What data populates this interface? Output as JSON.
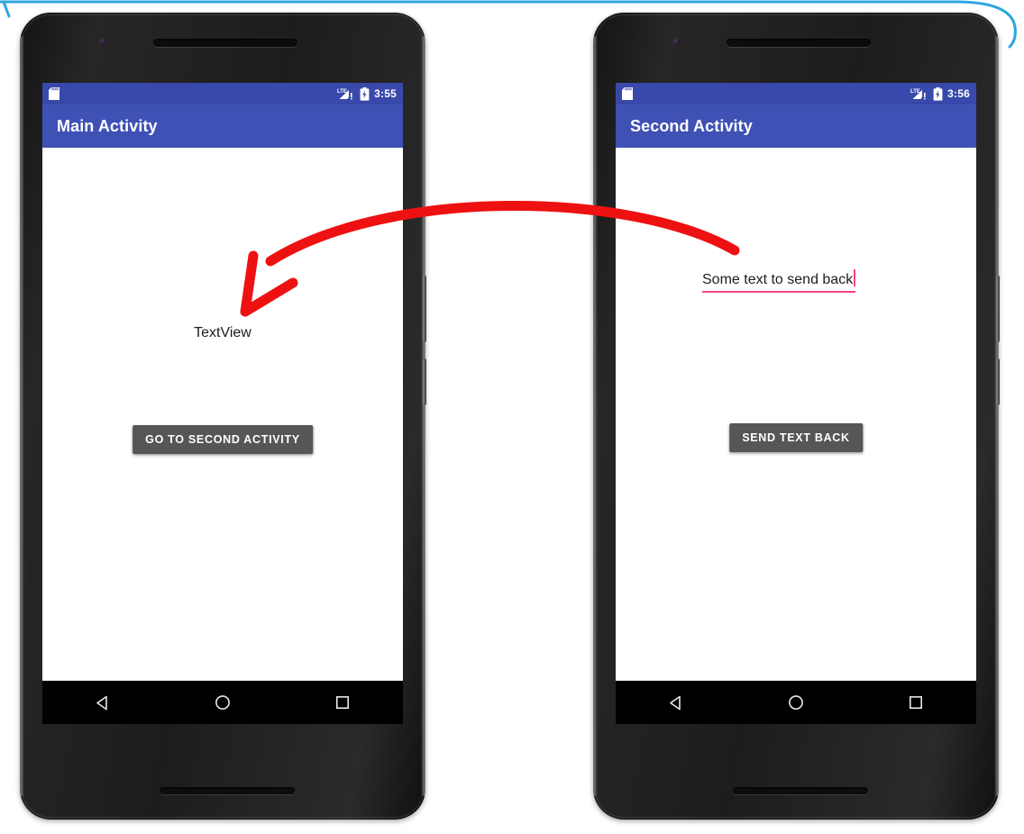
{
  "scene": {
    "description": "Two Android phone mockups side by side showing an activity-result demo, connected by a red hand-drawn arrow",
    "background_color": "#ffffff",
    "annotation_arrow": {
      "name": "red-curved-arrow",
      "color": "#ee1111",
      "direction": "right-to-left",
      "from": "second-activity-edittext",
      "to": "main-activity-textview"
    },
    "top_decoration": {
      "name": "cyan-corner-stroke",
      "color": "#2ca6e0"
    }
  },
  "phones": [
    {
      "id": "phone-left",
      "status_bar": {
        "sd_card_icon": "sd-card-icon",
        "signal_icon": "lte-signal-icon",
        "signal_label": "LTE",
        "signal_warning": "!",
        "battery_icon": "battery-icon",
        "time": "3:55"
      },
      "app_bar": {
        "title": "Main Activity"
      },
      "content": {
        "textview": {
          "name": "main-activity-textview",
          "text": "TextView"
        },
        "button": {
          "name": "go-to-second-activity-button",
          "label": "GO TO SECOND ACTIVITY",
          "background": "#565656",
          "text_color": "#ffffff"
        }
      },
      "nav_bar": {
        "back": "back-triangle-icon",
        "home": "home-circle-icon",
        "recents": "recents-square-icon"
      }
    },
    {
      "id": "phone-right",
      "status_bar": {
        "sd_card_icon": "sd-card-icon",
        "signal_icon": "lte-signal-icon",
        "signal_label": "LTE",
        "signal_warning": "!",
        "battery_icon": "battery-icon",
        "time": "3:56"
      },
      "app_bar": {
        "title": "Second Activity"
      },
      "content": {
        "edittext": {
          "name": "second-activity-edittext",
          "value": "Some text to send back",
          "placeholder": "",
          "underline_color": "#ff4081",
          "caret_color": "#ff4081",
          "focused": true
        },
        "button": {
          "name": "send-text-back-button",
          "label": "SEND TEXT BACK",
          "background": "#565656",
          "text_color": "#ffffff"
        }
      },
      "nav_bar": {
        "back": "back-triangle-icon",
        "home": "home-circle-icon",
        "recents": "recents-square-icon"
      }
    }
  ],
  "theme": {
    "status_bar_color": "#3949ab",
    "app_bar_color": "#3f51b5",
    "accent_color": "#ff4081",
    "screen_background": "#ffffff",
    "nav_bar_color": "#000000"
  }
}
